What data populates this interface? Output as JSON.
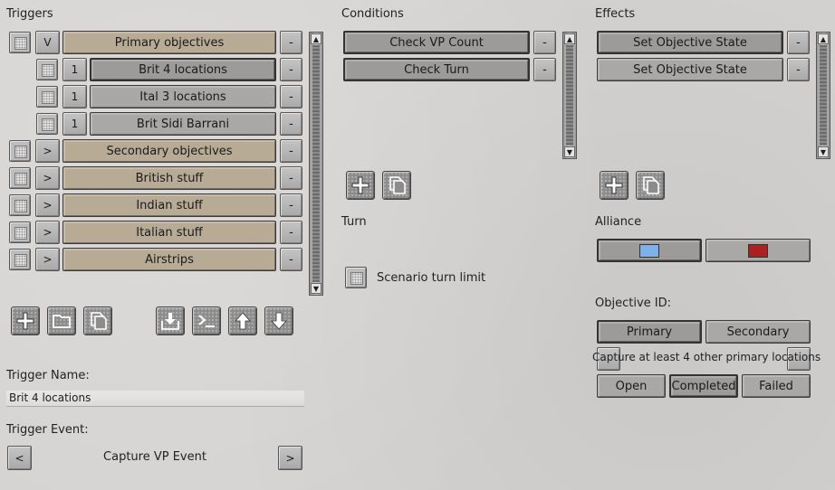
{
  "triggers": {
    "header": "Triggers",
    "items": [
      {
        "prefix": "V",
        "label": "Primary objectives",
        "level": 0,
        "style": "tan"
      },
      {
        "prefix": "1",
        "label": "Brit 4 locations",
        "level": 1,
        "style": "sel"
      },
      {
        "prefix": "1",
        "label": "Ital 3 locations",
        "level": 1,
        "style": "grey"
      },
      {
        "prefix": "1",
        "label": "Brit Sidi Barrani",
        "level": 1,
        "style": "grey"
      },
      {
        "prefix": ">",
        "label": "Secondary objectives",
        "level": 0,
        "style": "tan"
      },
      {
        "prefix": ">",
        "label": "British stuff",
        "level": 0,
        "style": "tan"
      },
      {
        "prefix": ">",
        "label": "Indian stuff",
        "level": 0,
        "style": "tan"
      },
      {
        "prefix": ">",
        "label": "Italian stuff",
        "level": 0,
        "style": "tan"
      },
      {
        "prefix": ">",
        "label": "Airstrips",
        "level": 0,
        "style": "tan"
      }
    ],
    "remove_label": "-",
    "toolbar_icons": [
      "add-icon",
      "folder-icon",
      "copy-icon",
      "import-icon",
      "console-icon",
      "move-up-icon",
      "move-down-icon"
    ]
  },
  "trigger_name": {
    "label": "Trigger Name:",
    "value": "Brit 4 locations"
  },
  "trigger_event": {
    "label": "Trigger Event:",
    "prev": "<",
    "value": "Capture VP Event",
    "next": ">"
  },
  "conditions": {
    "header": "Conditions",
    "items": [
      "Check VP Count",
      "Check Turn"
    ],
    "remove_label": "-"
  },
  "turn": {
    "header": "Turn",
    "checkbox_label": "Scenario turn limit"
  },
  "effects": {
    "header": "Effects",
    "items": [
      "Set Objective State",
      "Set Objective State"
    ],
    "remove_label": "-"
  },
  "alliance": {
    "header": "Alliance",
    "colors": [
      "#7fb0ee",
      "#b01f1f"
    ]
  },
  "objective": {
    "header": "Objective ID:",
    "types": [
      "Primary",
      "Secondary"
    ],
    "description": "Capture at least 4 other primary locations",
    "states": [
      "Open",
      "Completed",
      "Failed"
    ],
    "selected_state": "Completed"
  }
}
